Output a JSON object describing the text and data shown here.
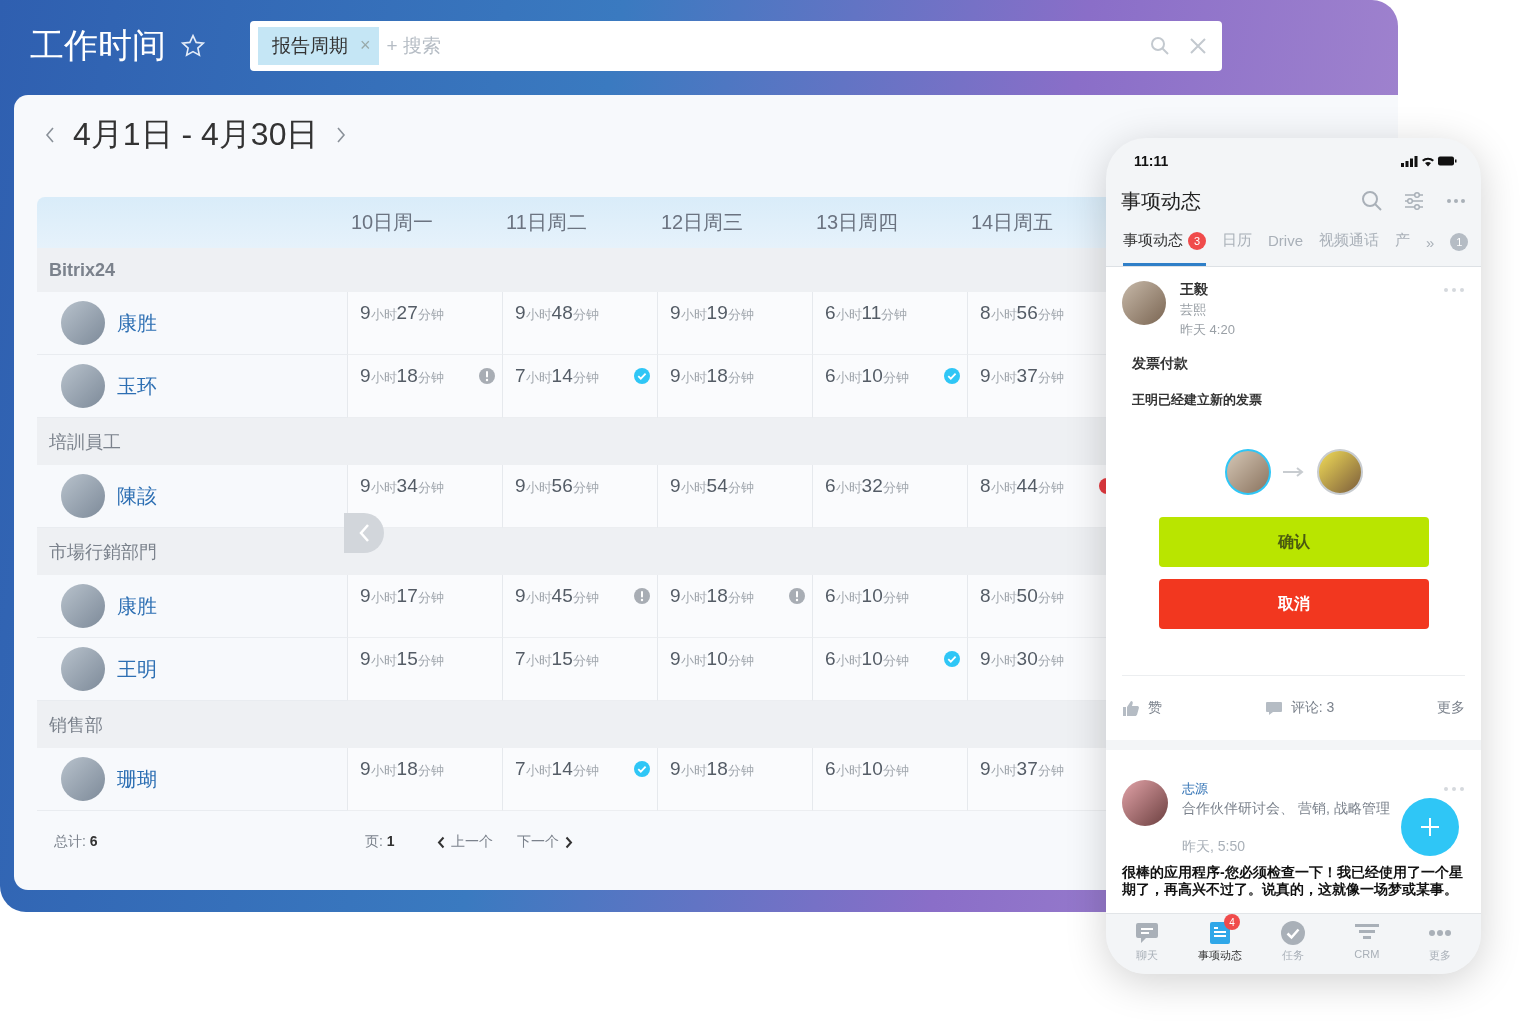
{
  "app": {
    "title": "工作时间",
    "filter_chip": "报告周期",
    "filter_chip_remove": "×",
    "search_placeholder": "+ 搜索"
  },
  "period": {
    "label": "4月1日 - 4月30日"
  },
  "table": {
    "columns": [
      "10日周一",
      "11日周二",
      "12日周三",
      "13日周四",
      "14日周五"
    ],
    "groups": [
      {
        "name": "Bitrix24",
        "people": [
          {
            "name": "康胜",
            "cells": [
              {
                "value": "**9**小时**27**分钟",
                "kind": "plain"
              },
              {
                "value": "**9**小时**48**分钟",
                "kind": "plain"
              },
              {
                "value": "**9**小时**19**分钟",
                "kind": "plain"
              },
              {
                "value": "**6**小时**11**分钟",
                "kind": "plain"
              },
              {
                "value": "**8**小时**56**分钟",
                "kind": "plain"
              }
            ]
          },
          {
            "name": "玉环",
            "cells": [
              {
                "value": "**9**小时**18**分钟",
                "kind": "warning"
              },
              {
                "value": "**7**小时**14**分钟",
                "kind": "done"
              },
              {
                "value": "**9**小时**18**分钟",
                "kind": "plain"
              },
              {
                "value": "**6**小时**10**分钟",
                "kind": "done"
              },
              {
                "value": "**9**小时**37**分钟",
                "kind": "plain"
              }
            ]
          }
        ]
      },
      {
        "name": "培訓員工",
        "people": [
          {
            "name": "陳該",
            "cells": [
              {
                "value": "**9**小时**34**分钟",
                "kind": "plain"
              },
              {
                "value": "**9**小时**56**分钟",
                "kind": "plain"
              },
              {
                "value": "**9**小时**54**分钟",
                "kind": "plain"
              },
              {
                "value": "**6**小时**32**分钟",
                "kind": "plain"
              },
              {
                "value": "**8**小时**44**分钟",
                "kind": "alert"
              }
            ]
          }
        ]
      },
      {
        "name": "市場行銷部門",
        "people": [
          {
            "name": "康胜",
            "cells": [
              {
                "value": "**9**小时**17**分钟",
                "kind": "plain"
              },
              {
                "value": "**9**小时**45**分钟",
                "kind": "warning"
              },
              {
                "value": "**9**小时**18**分钟",
                "kind": "warning"
              },
              {
                "value": "**6**小时**10**分钟",
                "kind": "plain"
              },
              {
                "value": "**8**小时**50**分钟",
                "kind": "plain"
              }
            ]
          },
          {
            "name": "王明",
            "cells": [
              {
                "value": "**9**小时**15**分钟",
                "kind": "plain"
              },
              {
                "value": "**7**小时**15**分钟",
                "kind": "plain"
              },
              {
                "value": "**9**小时**10**分钟",
                "kind": "plain"
              },
              {
                "value": "**6**小时**10**分钟",
                "kind": "done"
              },
              {
                "value": "**9**小时**30**分钟",
                "kind": "plain"
              }
            ]
          }
        ]
      },
      {
        "name": "销售部",
        "people": [
          {
            "name": "珊瑚",
            "cells": [
              {
                "value": "**9**小时**18**分钟",
                "kind": "plain"
              },
              {
                "value": "**7**小时**14**分钟",
                "kind": "done"
              },
              {
                "value": "**9**小时**18**分钟",
                "kind": "plain"
              },
              {
                "value": "**6**小时**10**分钟",
                "kind": "plain"
              },
              {
                "value": "**9**小时**37**分钟",
                "kind": "plain"
              }
            ]
          }
        ]
      }
    ]
  },
  "footer": {
    "total": "总计: **6**",
    "page": "页: **1**",
    "prev": "上一个",
    "next": "下一个"
  },
  "phone": {
    "time": "11:11",
    "title": "事项动态",
    "tabs": [
      {
        "label": "事项动态",
        "selected": true,
        "badge": "3"
      },
      {
        "label": "日历",
        "selected": false
      },
      {
        "label": "Drive",
        "selected": false
      },
      {
        "label": "视频通话",
        "selected": false
      },
      {
        "label": "产",
        "selected": false
      }
    ],
    "tabs_more": "»",
    "tabs_more_badge": "1",
    "post": {
      "author": "王毅",
      "subtitle": "芸熙",
      "time": "昨天 4:20",
      "title": "发票付款",
      "body": "王明已经建立新的发票",
      "confirm": "确认",
      "cancel": "取消",
      "like": "赞",
      "comments": "评论: 3",
      "more": "更多"
    },
    "post2": {
      "author": "志源",
      "subtitle": "合作伙伴研讨会、 营销, 战略管理",
      "time": "昨天, 5:50",
      "body": "很棒的应用程序-您必须检查一下！我已经使用了一个星期了，再高兴不过了。说真的，这就像一场梦或某事。"
    },
    "nav": [
      {
        "label": "聊天",
        "kind": "chat",
        "selected": false
      },
      {
        "label": "事项动态",
        "kind": "feed",
        "selected": true,
        "badge": "4"
      },
      {
        "label": "任务",
        "kind": "task",
        "selected": false
      },
      {
        "label": "CRM",
        "kind": "crm",
        "selected": false
      },
      {
        "label": "更多",
        "kind": "more",
        "selected": false
      }
    ]
  }
}
